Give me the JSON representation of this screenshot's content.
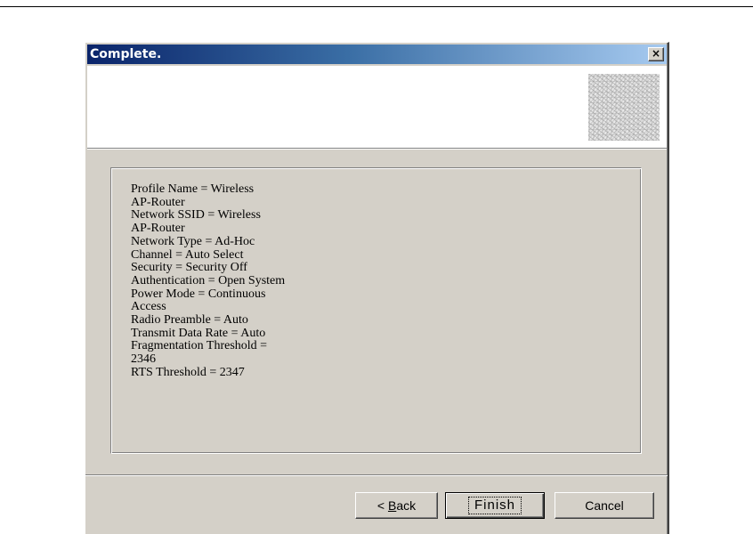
{
  "dialog": {
    "title": "Complete.",
    "close_label": "×"
  },
  "summary_lines": [
    "Profile Name = Wireless",
    "AP-Router",
    "Network SSID = Wireless",
    "AP-Router",
    "Network Type = Ad-Hoc",
    "Channel = Auto Select",
    "Security = Security Off",
    "Authentication = Open System",
    "Power Mode = Continuous",
    "Access",
    "Radio Preamble = Auto",
    "Transmit Data Rate = Auto",
    "Fragmentation Threshold =",
    "2346",
    "RTS Threshold = 2347"
  ],
  "buttons": {
    "back_prefix": "< ",
    "back_mnemonic": "B",
    "back_rest": "ack",
    "finish": "Finish",
    "cancel": "Cancel"
  },
  "colors": {
    "face": "#d4d0c8",
    "title_start": "#0a246a",
    "title_end": "#a6caf0"
  }
}
